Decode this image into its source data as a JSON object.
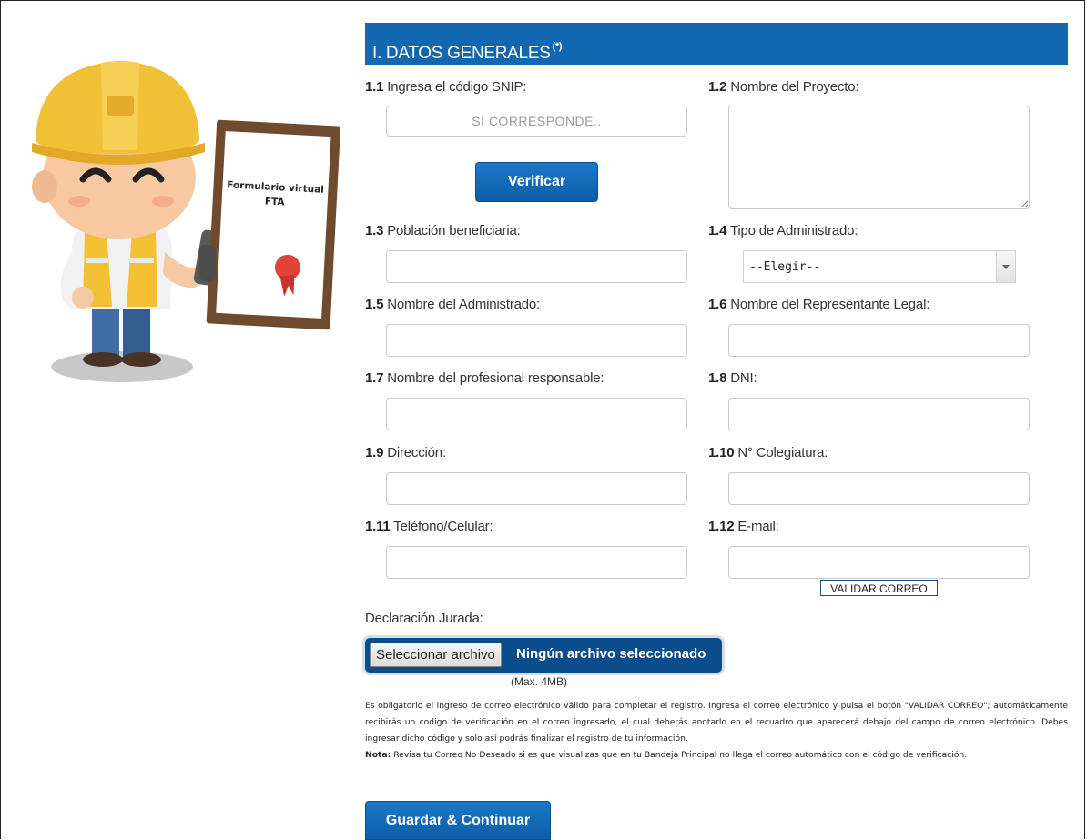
{
  "section": {
    "title": "I. DATOS GENERALES",
    "title_suffix": "(*)"
  },
  "illustration": {
    "certificate_text_line1": "Formulario virtual",
    "certificate_text_line2": "FTA"
  },
  "fields": {
    "snip": {
      "num": "1.1",
      "label": "Ingresa el código SNIP:",
      "placeholder": "SI CORRESPONDE..",
      "value": ""
    },
    "verify_button": "Verificar",
    "project_name": {
      "num": "1.2",
      "label": "Nombre del Proyecto:",
      "value": ""
    },
    "population": {
      "num": "1.3",
      "label": "Población beneficiaria:",
      "value": ""
    },
    "admin_type": {
      "num": "1.4",
      "label": "Tipo de Administrado:",
      "selected": "--Elegir--"
    },
    "admin_name": {
      "num": "1.5",
      "label": "Nombre del Administrado:",
      "value": ""
    },
    "legal_rep": {
      "num": "1.6",
      "label": "Nombre del Representante Legal:",
      "value": ""
    },
    "professional": {
      "num": "1.7",
      "label": "Nombre del profesional responsable:",
      "value": ""
    },
    "dni": {
      "num": "1.8",
      "label": "DNI:",
      "value": ""
    },
    "address": {
      "num": "1.9",
      "label": "Dirección:",
      "value": ""
    },
    "colegiatura": {
      "num": "1.10",
      "label": "N° Colegiatura:",
      "value": ""
    },
    "phone": {
      "num": "1.11",
      "label": "Teléfono/Celular:",
      "value": ""
    },
    "email": {
      "num": "1.12",
      "label": "E-mail:",
      "value": ""
    },
    "validate_email_button": "VALIDAR CORREO"
  },
  "declaration": {
    "label": "Declaración Jurada:",
    "file_button": "Seleccionar archivo",
    "file_status": "Ningún archivo seleccionado",
    "max_size": "(Max. 4MB)"
  },
  "notice": {
    "text": "Es obligatorio el ingreso de correo electrónico válido para completar el registro. Ingresa el correo electrónico y pulsa el botón \"VALIDAR CORREO\"; automáticamente recibirás un codigo de verificación en el correo ingresado, el cual deberás anotarlo en el recuadro que aparecerá debajo del campo de correo electrónico. Debes ingresar dicho código y solo así podrás finalizar el registro de tu información.",
    "note_label": "Nota:",
    "note_text": " Revisa tu Correo No Deseado si es que visualizas que en tu Bandeja Principal no llega el correo automático con el código de verificación."
  },
  "submit_button": "Guardar & Continuar",
  "colors": {
    "header_blue": "#1267b1",
    "button_blue": "#0d5ea8",
    "file_bar": "#0a4d8c"
  }
}
